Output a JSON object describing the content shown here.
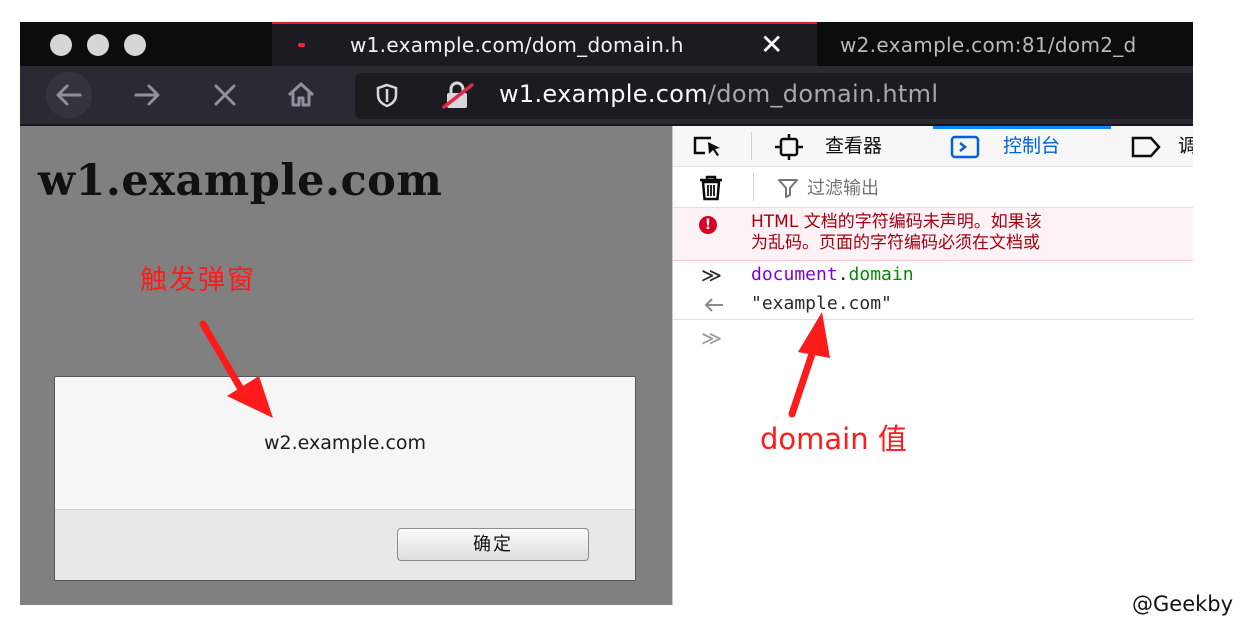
{
  "browser": {
    "active_tab_title": "w1.example.com/dom_domain.h",
    "second_tab_title": "w2.example.com:81/dom2_d",
    "url_host": "w1.example.com",
    "url_path": "/dom_domain.html"
  },
  "page": {
    "heading": "w1.example.com",
    "alert_message": "w2.example.com",
    "ok_button_label": "确定"
  },
  "devtools": {
    "tabs": {
      "inspector": "查看器",
      "console": "控制台",
      "debugger": "调"
    },
    "filter_placeholder": "过滤输出",
    "error_line1": "HTML 文档的字符编码未声明。如果该",
    "error_line2": "为乱码。页面的字符编码必须在文档或",
    "input_object": "document",
    "input_dot": ".",
    "input_property": "domain",
    "result_value": "\"example.com\""
  },
  "annotations": {
    "trigger_popup": "触发弹窗",
    "domain_value": "domain 值",
    "watermark": "@Geekby"
  },
  "colors": {
    "annotation_red": "#ff1b1b",
    "console_blue": "#0060df",
    "error_red": "#a4000f"
  }
}
